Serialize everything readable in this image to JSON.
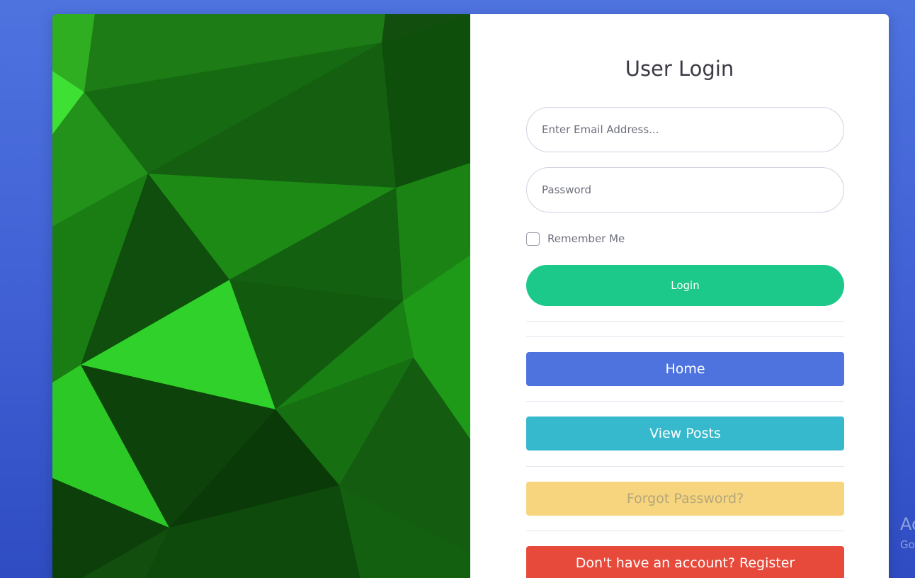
{
  "login": {
    "title": "User Login",
    "email_placeholder": "Enter Email Address...",
    "password_placeholder": "Password",
    "remember_label": "Remember Me",
    "login_label": "Login"
  },
  "links": {
    "home": "Home",
    "view_posts": "View Posts",
    "forgot_password": "Forgot Password?",
    "register": "Don't have an account? Register"
  },
  "watermark": {
    "line1": "Ac",
    "line2": "Go"
  },
  "colors": {
    "page_background": "#4e73df",
    "login_button": "#1cc88a",
    "home_button": "#4e73df",
    "view_posts_button": "#36b9cc",
    "forgot_button": "#f6d57e",
    "register_button": "#e74a3b"
  }
}
